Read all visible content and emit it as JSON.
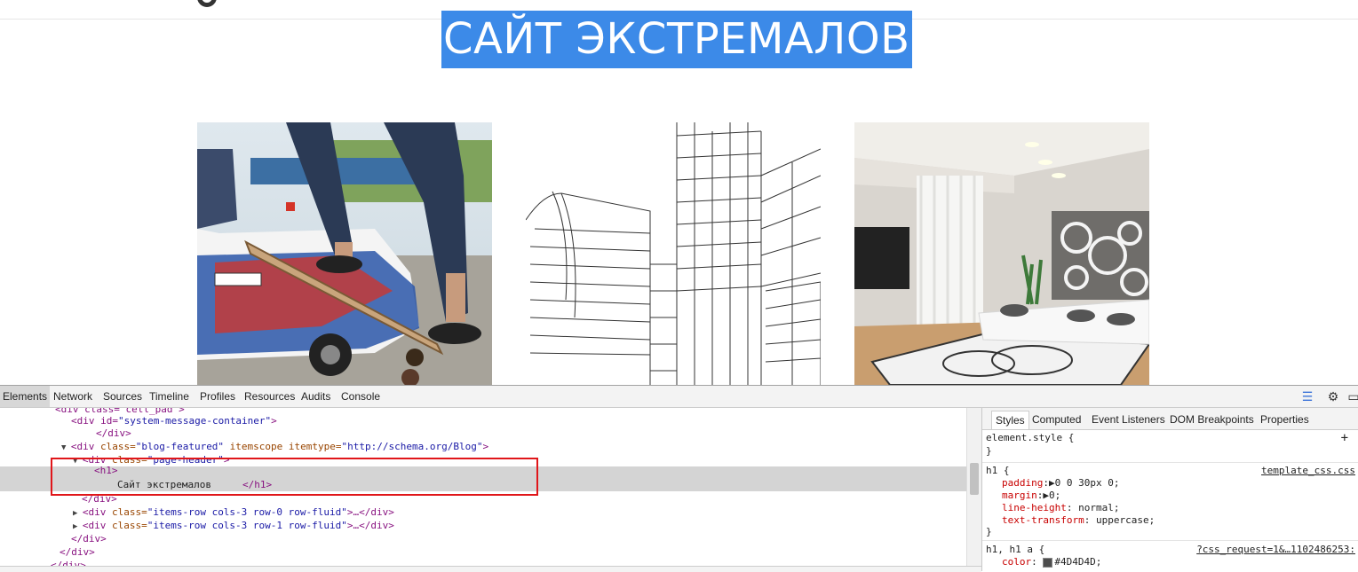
{
  "site": {
    "title": "САЙТ ЭКСТРЕМАЛОВ",
    "selection_color": "#3c8ae8"
  },
  "featured_images": [
    {
      "name": "skateboard-photo"
    },
    {
      "name": "building-sketch-photo"
    },
    {
      "name": "living-room-photo"
    }
  ],
  "devtools": {
    "tabs": [
      "Elements",
      "Network",
      "Sources",
      "Timeline",
      "Profiles",
      "Resources",
      "Audits",
      "Console"
    ],
    "active_tab": "Elements",
    "icons": [
      "execute-icon",
      "gear-icon",
      "dock-icon"
    ],
    "dom": {
      "line0": "<div class=\"cell_pad\">",
      "line1_tag": "<div id=",
      "line1_val": "\"system-message-container\"",
      "line1_end": ">",
      "line2": "</div>",
      "line3": {
        "open": "<div ",
        "a1": "class=",
        "v1": "\"blog-featured\"",
        "a2": " itemscope itemtype=",
        "v2": "\"http://schema.org/Blog\"",
        "close": ">"
      },
      "line4": {
        "open": "<div ",
        "a1": "class=",
        "v1": "\"page-header\"",
        "close": ">"
      },
      "line5": "<h1>",
      "line6_text": "Сайт экстремалов",
      "line6_close": "</h1>",
      "line7": "</div>",
      "line8": {
        "open": "<div ",
        "a1": "class=",
        "v1": "\"items-row cols-3 row-0 row-fluid\"",
        "close": ">…</div>"
      },
      "line9": {
        "open": "<div ",
        "a1": "class=",
        "v1": "\"items-row cols-3 row-1 row-fluid\"",
        "close": ">…</div>"
      },
      "line10": "</div>",
      "line11": "</div>",
      "line12": "</div>"
    },
    "styles": {
      "tabs": [
        "Styles",
        "Computed",
        "Event Listeners",
        "DOM Breakpoints",
        "Properties"
      ],
      "active_tab": "Styles",
      "element_style": "element.style {",
      "close_brace": "}",
      "plus": "+",
      "rule1": {
        "selector": "h1 {",
        "source": "template_css.css",
        "decls": [
          {
            "prop": "padding",
            "val": "▶0 0 30px 0;"
          },
          {
            "prop": "margin",
            "val": "▶0;"
          },
          {
            "prop": "line-height",
            "val": " normal;"
          },
          {
            "prop": "text-transform",
            "val": " uppercase;"
          }
        ]
      },
      "rule2": {
        "selector": "h1, h1 a {",
        "source": "?css_request=1&…1102486253:",
        "decl_prop": "color",
        "decl_val": "#4D4D4D;",
        "color": "#4D4D4D"
      }
    }
  }
}
